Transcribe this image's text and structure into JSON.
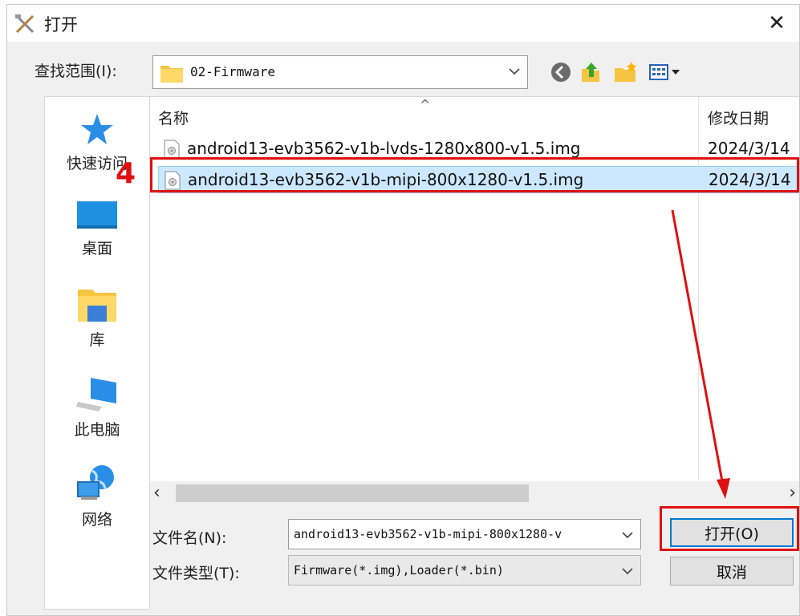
{
  "window": {
    "title": "打开",
    "close_glyph": "✕"
  },
  "toolbar": {
    "lookin_label": "查找范围(I):",
    "lookin_value": "02-Firmware",
    "icons": [
      "back-icon",
      "up-folder-icon",
      "new-folder-icon",
      "view-menu-icon"
    ]
  },
  "places": [
    {
      "label": "快速访问",
      "icon": "star-icon"
    },
    {
      "label": "桌面",
      "icon": "desktop-icon"
    },
    {
      "label": "库",
      "icon": "library-icon"
    },
    {
      "label": "此电脑",
      "icon": "computer-icon"
    },
    {
      "label": "网络",
      "icon": "network-icon"
    }
  ],
  "file_list": {
    "columns": {
      "name": "名称",
      "date": "修改日期"
    },
    "sort_glyph": "^",
    "rows": [
      {
        "name": "android13-evb3562-v1b-lvds-1280x800-v1.5.img",
        "date": "2024/3/14",
        "selected": false
      },
      {
        "name": "android13-evb3562-v1b-mipi-800x1280-v1.5.img",
        "date": "2024/3/14",
        "selected": true
      }
    ]
  },
  "scrollbar": {
    "left_glyph": "‹",
    "right_glyph": "›"
  },
  "form": {
    "filename_label": "文件名(N):",
    "filename_value": "android13-evb3562-v1b-mipi-800x1280-v",
    "filetype_label": "文件类型(T):",
    "filetype_value": "Firmware(*.img),Loader(*.bin)"
  },
  "buttons": {
    "open_label": "打开(O)",
    "cancel_label": "取消"
  },
  "annotation": {
    "step_number": "4",
    "color": "#e01010"
  },
  "colors": {
    "selection": "#cce8ff",
    "primary_border": "#0078d7"
  }
}
